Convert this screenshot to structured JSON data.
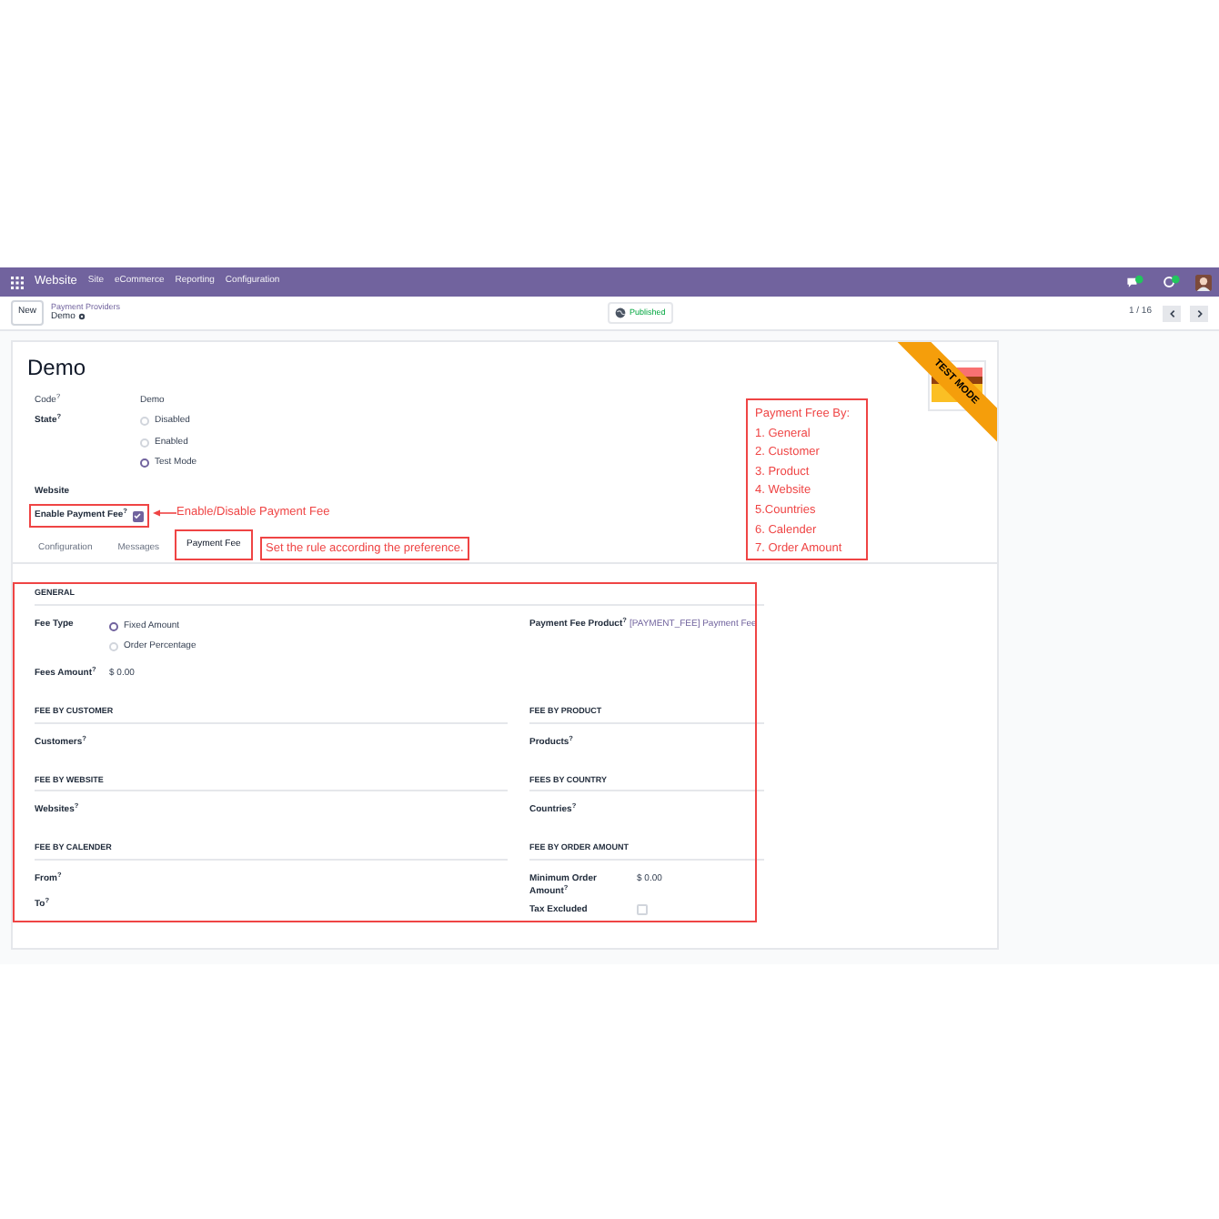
{
  "navbar": {
    "app": "Website",
    "menus": [
      "Site",
      "eCommerce",
      "Reporting",
      "Configuration"
    ]
  },
  "control_panel": {
    "new_button": "New",
    "breadcrumb": "Payment Providers",
    "record": "Demo",
    "status": "Published",
    "pager": "1 / 16"
  },
  "form": {
    "ribbon": "TEST MODE",
    "title": "Demo",
    "code": {
      "label": "Code$^{?}$",
      "value": "Demo"
    },
    "state": {
      "label": "State$^{?}$",
      "options": [
        {
          "label": "Disabled",
          "selected": false
        },
        {
          "label": "Enabled",
          "selected": false
        },
        {
          "label": "Test Mode",
          "selected": true
        }
      ]
    },
    "website": {
      "label": "Website"
    },
    "enable_payment_fee": {
      "label": "Enable Payment Fee$^{?}$",
      "checked": true
    },
    "tabs": [
      {
        "label": "Configuration",
        "selected": false
      },
      {
        "label": "Messages",
        "selected": false
      },
      {
        "label": "Payment Fee",
        "selected": true
      }
    ],
    "general": {
      "heading": "GENERAL",
      "left": [
        {
          "kind": "radio",
          "label": "Fee Type",
          "options": [
            {
              "label": "Fixed Amount",
              "selected": true
            },
            {
              "label": "Order Percentage",
              "selected": false
            }
          ]
        },
        {
          "kind": "text",
          "label": "Fees Amount$^{?}$",
          "value": "$ 0.00"
        }
      ],
      "right": [
        {
          "kind": "link",
          "label": "Payment Fee Product$^{?}$",
          "value": "[PAYMENT_FEE] Payment Fee"
        }
      ]
    },
    "sections": [
      {
        "left": {
          "heading": "FEE BY CUSTOMER",
          "fields": [
            {
              "label": "Customers$^{?}$"
            }
          ]
        },
        "right": {
          "heading": "FEE BY PRODUCT",
          "fields": [
            {
              "label": "Products$^{?}$"
            }
          ]
        }
      },
      {
        "left": {
          "heading": "FEE BY WEBSITE",
          "fields": [
            {
              "label": "Websites$^{?}$"
            }
          ]
        },
        "right": {
          "heading": "FEES BY COUNTRY",
          "fields": [
            {
              "label": "Countries$^{?}$"
            }
          ]
        }
      },
      {
        "left": {
          "heading": "FEE BY CALENDER",
          "fields": [
            {
              "label": "From$^{?}$"
            },
            {
              "label": "To$^{?}$"
            }
          ]
        },
        "right": {
          "heading": "FEE BY ORDER AMOUNT",
          "fields": [
            {
              "kind": "text",
              "label": "Minimum Order Amount$^{?}$",
              "value": "$ 0.00"
            },
            {
              "kind": "checkbox",
              "label": "Tax Excluded",
              "checked": false
            }
          ]
        }
      }
    ]
  },
  "annotations": {
    "enable_note": "Enable/Disable Payment Fee",
    "tab_note": "Set the rule according the preference.",
    "list": [
      "Payment Free By:",
      "1. General",
      "2. Customer",
      "3. Product",
      "4. Website",
      "5.Countries",
      "6. Calender",
      "7. Order Amount"
    ]
  }
}
